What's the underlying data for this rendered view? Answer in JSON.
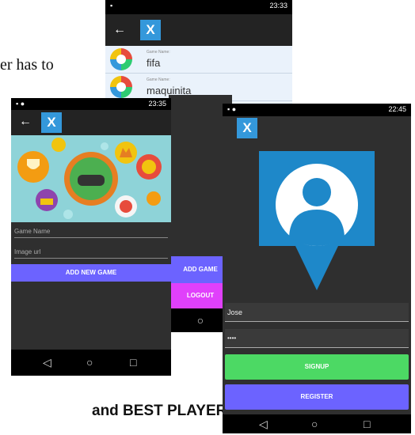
{
  "document": {
    "text_top": "er has to",
    "text_bottom": "and BEST PLAYER\"."
  },
  "phone_list": {
    "status_time": "23:33",
    "items": [
      {
        "label": "Game Name:",
        "name": "fifa"
      },
      {
        "label": "Game Name:",
        "name": "maquinita"
      }
    ]
  },
  "phone_add": {
    "status_time": "23:35",
    "game_name_placeholder": "Game Name",
    "image_url_placeholder": "Image url",
    "add_button": "ADD NEW GAME"
  },
  "side_buttons": {
    "add_game": "ADD GAME",
    "logout": "LOGOUT"
  },
  "phone_login": {
    "status_time": "22:45",
    "username_value": "Jose",
    "password_value": "••••",
    "signup_button": "SIGNUP",
    "register_button": "REGISTER"
  },
  "icons": [
    "back-arrow-icon",
    "xamarin-logo-icon",
    "nav-back-icon",
    "nav-home-icon",
    "nav-recent-icon",
    "user-avatar-icon",
    "game-controller-icon"
  ],
  "colors": {
    "xamarin_blue": "#3498db",
    "purple_button": "#6c63ff",
    "pink_button": "#e040fb",
    "green_button": "#4cd964",
    "avatar_blue": "#1e88c9"
  }
}
